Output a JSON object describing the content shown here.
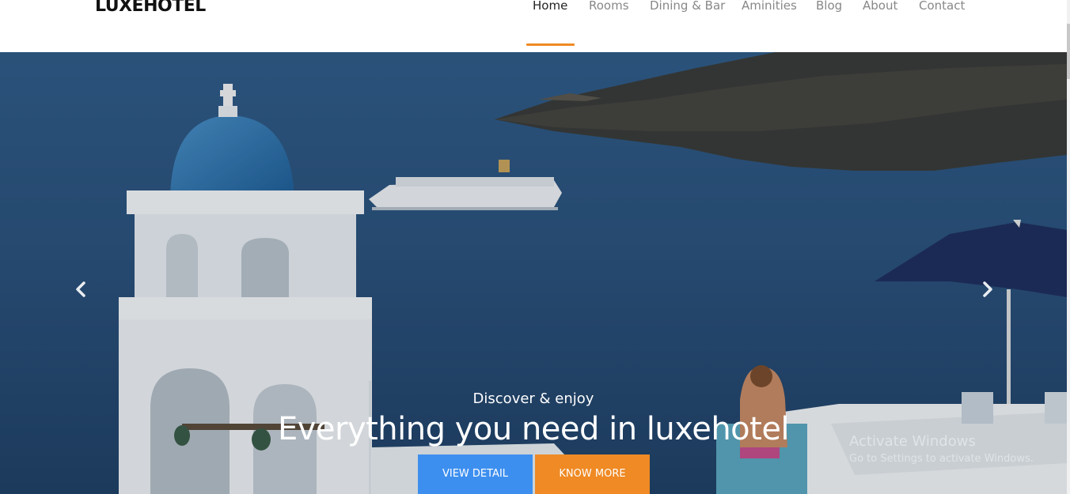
{
  "brand": {
    "logo": "LUXEHOTEL"
  },
  "nav": {
    "items": [
      {
        "label": "Home",
        "active": true
      },
      {
        "label": "Rooms"
      },
      {
        "label": "Dining & Bar"
      },
      {
        "label": "Aminities"
      },
      {
        "label": "Blog"
      },
      {
        "label": "About"
      },
      {
        "label": "Contact"
      }
    ]
  },
  "hero": {
    "subtitle": "Discover & enjoy",
    "title": "Everything you need in luxehotel",
    "buttons": {
      "view_detail": "VIEW DETAIL",
      "know_more": "KNOW MORE"
    },
    "prev_icon": "chevron-left-icon",
    "next_icon": "chevron-right-icon"
  },
  "watermark": {
    "title": "Activate Windows",
    "subtitle": "Go to Settings to activate Windows."
  },
  "colors": {
    "accent_orange": "#ef8a24",
    "accent_blue": "#3d8fef",
    "nav_active": "#222222",
    "nav_inactive": "#888888"
  }
}
